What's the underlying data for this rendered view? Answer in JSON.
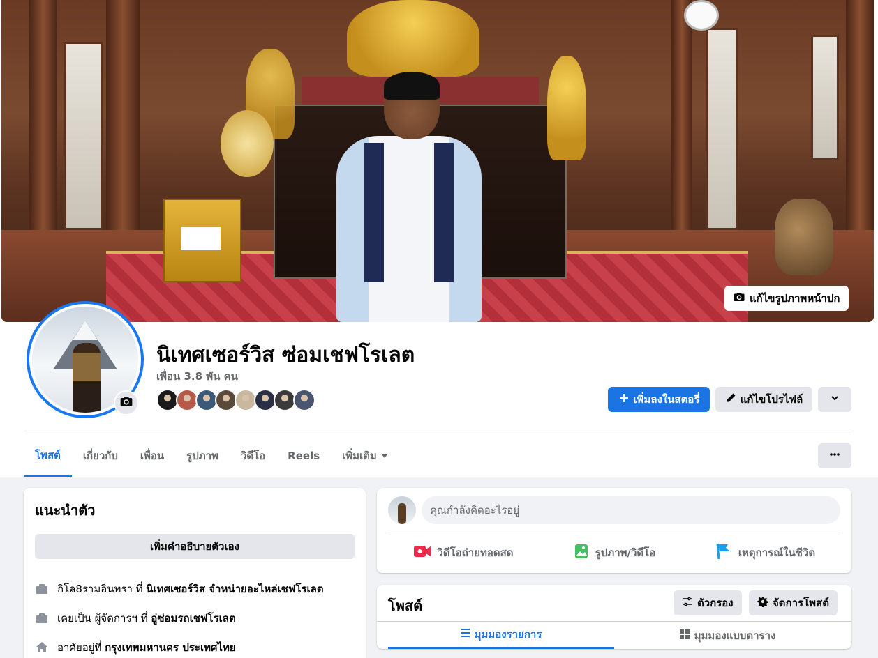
{
  "cover": {
    "edit_label": "แก้ไขรูปภาพหน้าปก"
  },
  "profile": {
    "name": "นิเทศเซอร์วิส ซ่อมเชฟโรเลต",
    "friends_count": "เพื่อน 3.8 พัน คน",
    "friend_avatar_colors": [
      "#1a1a1a",
      "#b65a4a",
      "#3b5a7a",
      "#5a4a3a",
      "#c9b8a0",
      "#2a2f45",
      "#3a3a3a",
      "#4a5670"
    ]
  },
  "actions": {
    "add_story": "เพิ่มลงในสตอรี่",
    "edit_profile": "แก้ไขโปรไฟล์"
  },
  "tabs": [
    {
      "label": "โพสต์",
      "active": true
    },
    {
      "label": "เกี่ยวกับ"
    },
    {
      "label": "เพื่อน"
    },
    {
      "label": "รูปภาพ"
    },
    {
      "label": "วิดีโอ"
    },
    {
      "label": "Reels"
    },
    {
      "label": "เพิ่มเติม"
    }
  ],
  "intro": {
    "title": "แนะนำตัว",
    "bio_button": "เพิ่มคำอธิบายตัวเอง",
    "items": [
      {
        "icon": "briefcase-icon",
        "prefix": "กิโล8รามอินทรา ที่ ",
        "bold": "นิเทศเซอร์วิส จำหน่ายอะไหล่เชฟโรเลต"
      },
      {
        "icon": "briefcase-icon",
        "prefix": "เคยเป็น ผู้จัดการฯ ที่ ",
        "bold": "อู่ซ่อมรถเชฟโรเลต"
      },
      {
        "icon": "home-icon",
        "prefix": "อาศัยอยู่ที่ ",
        "bold": "กรุงเทพมหานคร ประเทศไทย"
      }
    ]
  },
  "composer": {
    "placeholder": "คุณกำลังคิดอะไรอยู่",
    "live_video": "วิดีโอถ่ายทอดสด",
    "photo_video": "รูปภาพ/วิดีโอ",
    "life_event": "เหตุการณ์ในชีวิต"
  },
  "posts": {
    "title": "โพสต์",
    "filter": "ตัวกรอง",
    "manage": "จัดการโพสต์",
    "list_view": "มุมมองรายการ",
    "grid_view": "มุมมองแบบตาราง"
  },
  "colors": {
    "accent": "#1b74e4",
    "live_red": "#f02849",
    "photo_green": "#45bd62",
    "event_blue": "#1b9ded"
  }
}
